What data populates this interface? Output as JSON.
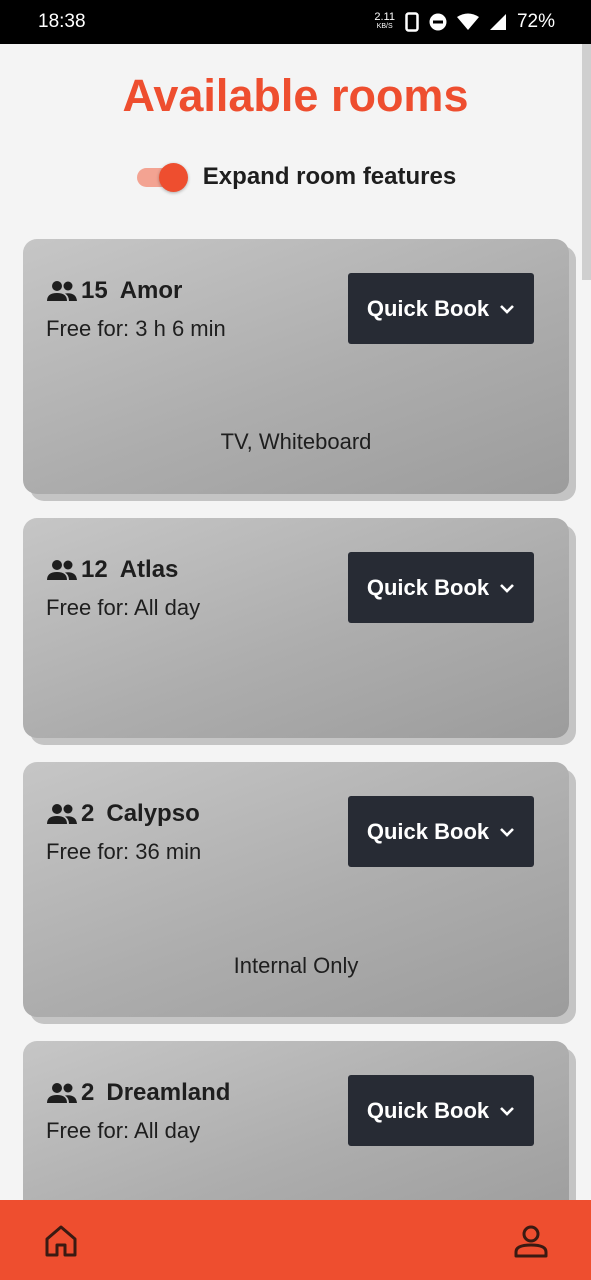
{
  "status_bar": {
    "time": "18:38",
    "net_speed_value": "2.11",
    "net_speed_unit": "KB/S",
    "battery": "72%",
    "icons": [
      "phone-icon",
      "dnd-icon",
      "wifi-icon",
      "signal-icon"
    ]
  },
  "header": {
    "title": "Available rooms"
  },
  "toggle": {
    "label": "Expand room features",
    "on": true
  },
  "rooms": [
    {
      "capacity": "15",
      "name": "Amor",
      "free": "Free for: 3 h 6 min",
      "button": "Quick Book",
      "features": "TV, Whiteboard"
    },
    {
      "capacity": "12",
      "name": "Atlas",
      "free": "Free for: All day",
      "button": "Quick Book",
      "features": ""
    },
    {
      "capacity": "2",
      "name": "Calypso",
      "free": "Free for: 36 min",
      "button": "Quick Book",
      "features": "Internal Only"
    },
    {
      "capacity": "2",
      "name": "Dreamland",
      "free": "Free for: All day",
      "button": "Quick Book",
      "features": ""
    }
  ],
  "nav": {
    "items": [
      "home-icon",
      "profile-icon"
    ]
  },
  "colors": {
    "accent": "#ee4e2f",
    "button": "#272b34",
    "card": "#b3b3b3",
    "background": "#f4f4f4"
  }
}
